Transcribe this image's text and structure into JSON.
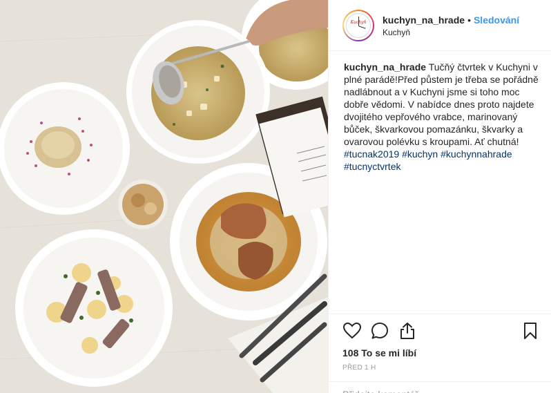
{
  "post": {
    "username": "kuchyn_na_hrade",
    "dot": "•",
    "follow_label": "Sledování",
    "location": "Kuchyň",
    "avatar_brand": "Kuchyň"
  },
  "caption": {
    "username": "kuchyn_na_hrade",
    "text": "Tučňý čtvrtek v Kuchyni v plné parádě!Před půstem je třeba se pořádně nadlábnout a v Kuchyni jsme si toho moc dobře vědomi. V nabídce dnes proto najdete dvojitého vepřového vrabce, marinovaný bůček, škvarkovou pomazánku, škvarky a ovarovou polévku s kroupami. Ať chutná!",
    "hashtags": [
      "#tucnak2019",
      "#kuchyn",
      "#kuchynnahrade",
      "#tucnyctvrtek"
    ]
  },
  "actions": {
    "like_icon": "heart-icon",
    "comment_icon": "comment-icon",
    "share_icon": "share-icon",
    "save_icon": "bookmark-icon"
  },
  "likes_label": "108 To se mi líbí",
  "time_label": "PŘED 1 H",
  "comment_placeholder": "Přidejte komentář...",
  "colors": {
    "link": "#3897f0",
    "hashtag": "#003569",
    "muted": "#999999",
    "border": "#efefef"
  }
}
